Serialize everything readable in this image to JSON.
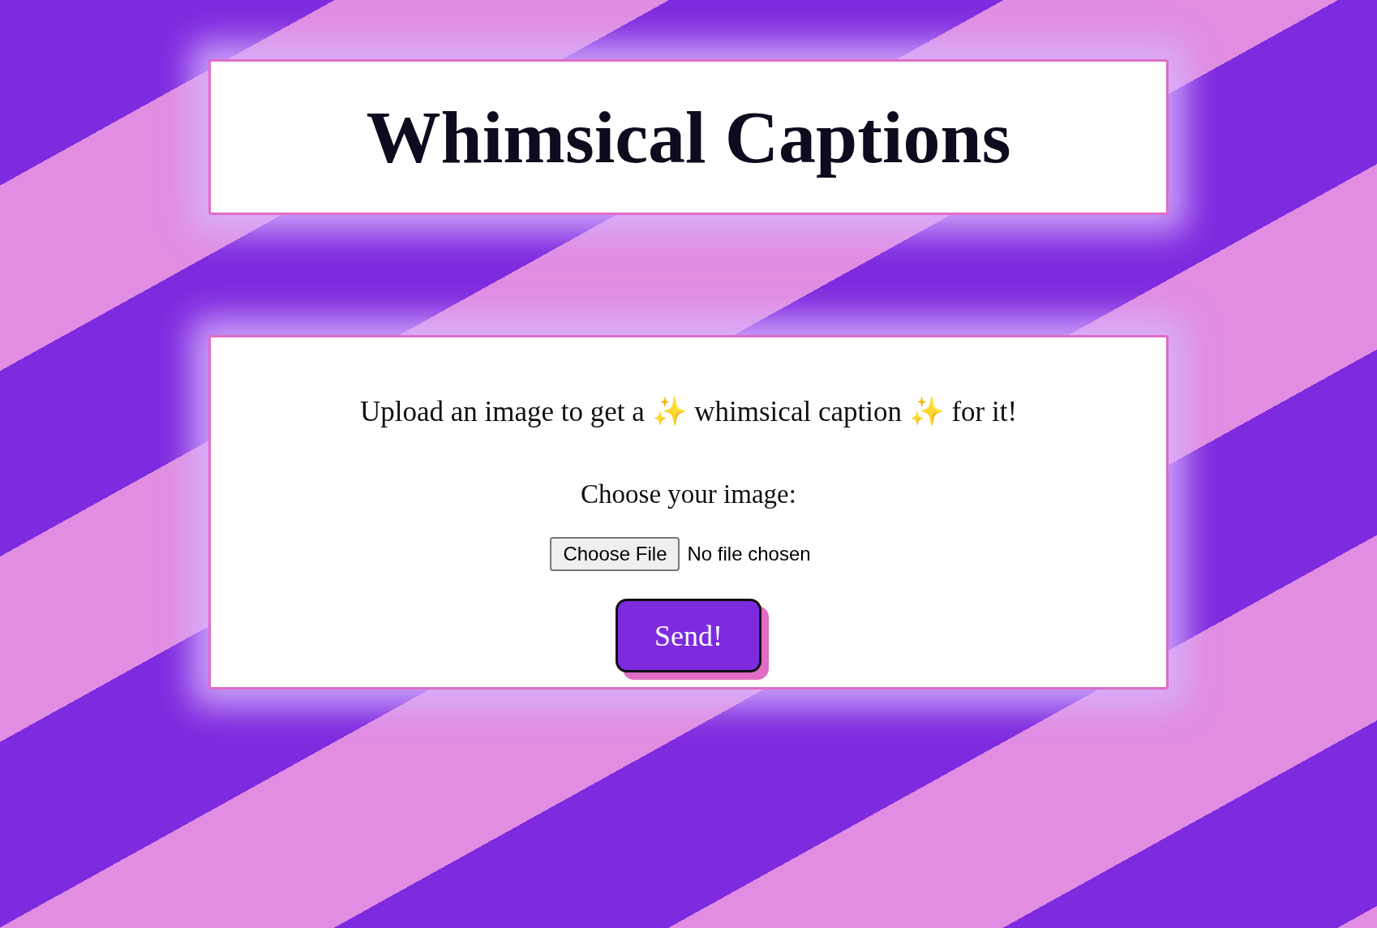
{
  "title": "Whimsical Captions",
  "upload": {
    "intro": "Upload an image to get a ✨ whimsical caption ✨ for it!",
    "label": "Choose your image:",
    "file_button": "Choose File",
    "file_status": "No file chosen",
    "submit": "Send!"
  }
}
